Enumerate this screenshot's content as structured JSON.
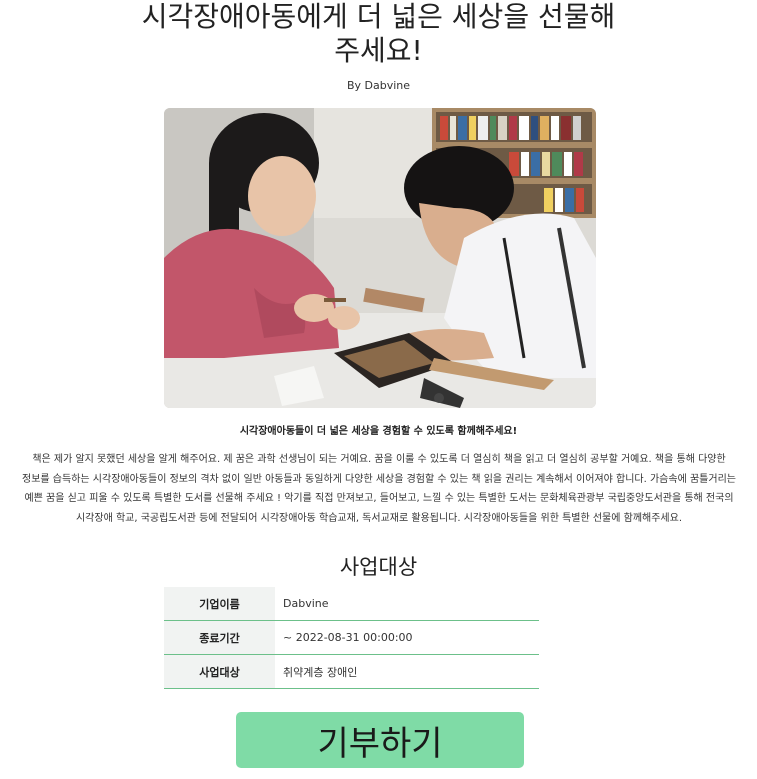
{
  "title": "시각장애아동에게 더 넓은 세상을 선물해주세요!",
  "author": "By Dabvine",
  "photo": {
    "alt": "시각장애아동들이 더 넓은 세상을 경험할 수 있도록 함께해주세요!"
  },
  "caption": "시각장애아동들이 더 넓은 세상을 경험할 수 있도록 함께해주세요!",
  "description": "책은 제가 알지 못했던 세상을 알게 해주어요. 제 꿈은 과학 선생님이 되는 거예요. 꿈을 이룰 수 있도록 더 열심히 책을 읽고 더 열심히 공부할 거예요. 책을 통해 다양한 정보를 습득하는 시각장애아동들이 정보의 격차 없이 일반 아동들과 동일하게 다양한 세상을 경험할 수 있는 책 읽을 권리는 계속해서 이어져야 합니다. 가슴속에 꿈틀거리는 예쁜 꿈을 싣고 피울 수 있도록 특별한 도서를 선물해 주세요 ! 악기를 직접 만져보고, 들어보고, 느낄 수 있는 특별한 도서는 문화체육관광부 국립중앙도서관을 통해 전국의 시각장애 학교, 국공립도서관 등에 전달되어 시각장애아동 학습교재, 독서교재로 활용됩니다. 시각장애아동들을 위한 특별한 선물에 함께해주세요.",
  "section_title": "사업대상",
  "info_rows": [
    {
      "label": "기업이름",
      "value": "Dabvine"
    },
    {
      "label": "종료기간",
      "value": "~ 2022-08-31 00:00:00"
    },
    {
      "label": "사업대상",
      "value": "취약계층 장애인"
    }
  ],
  "donate_button": "기부하기",
  "colors": {
    "accent": "#7fdba6",
    "table_rule": "#6cc08a",
    "label_bg": "#f1f3f2"
  }
}
